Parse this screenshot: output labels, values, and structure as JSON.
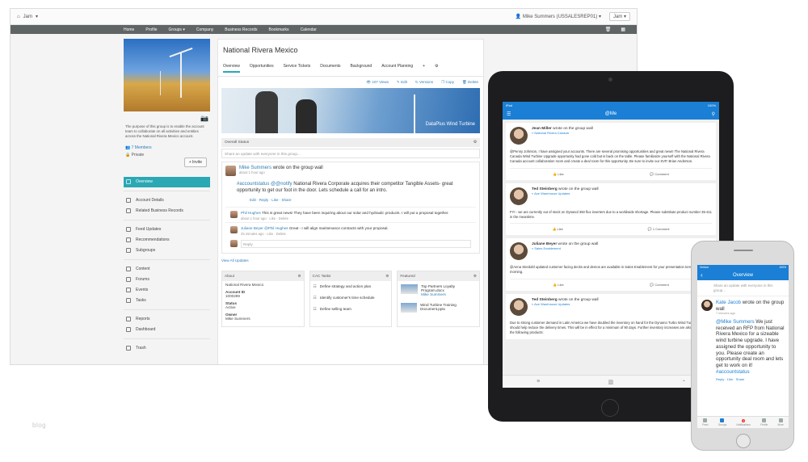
{
  "desktop": {
    "topbar": {
      "brand": "Jam",
      "user": "Mike Summers (USSALESREP01)",
      "jam_button": "Jam"
    },
    "nav": [
      "Home",
      "Profile",
      "Groups",
      "Company",
      "Business Records",
      "Bookmarks",
      "Calendar"
    ],
    "group": {
      "description": "The purpose of this group is to enable the account team to collaborate on all activities and entities across the National Rivera Mexico account.",
      "members": "7 Members",
      "privacy": "Private",
      "invite": "+ Invite"
    },
    "sidebar": [
      "Overview",
      "Account Details",
      "Related Business Records",
      "Feed Updates",
      "Recommendations",
      "Subgroups",
      "Content",
      "Forums",
      "Events",
      "Tasks",
      "Reports",
      "Dashboard",
      "Trash"
    ],
    "title": "National Rivera Mexico",
    "tabs": [
      "Overview",
      "Opportunities",
      "Service Tickets",
      "Documents",
      "Background",
      "Account Planning",
      "+"
    ],
    "actions": [
      "107 Views",
      "Edit",
      "Versions",
      "Copy",
      "Delete"
    ],
    "banner_caption": "DataPlus Wind Turbine",
    "status_header": "Overall Status",
    "share_placeholder": "Share an update with everyone in this group...",
    "post": {
      "author": "Mike Summers",
      "verb": "wrote on the group wall",
      "time": "about 1 hour ago",
      "tag1": "#accountstatus",
      "tag2": "@@notify",
      "body": " National Rivera Corporate acquires their competitor Tangible Assets- great opportunity to get our foot in the door. Lets schedule a call for an intro.",
      "links": "Edit · Reply · Like · Share"
    },
    "replies": [
      {
        "author": "Phil Hughes",
        "body": " This is great news! They have been inquiring about our solar and hydraulic products. I will put a proposal together.",
        "time": "about 1 hour ago · Like · Delete"
      },
      {
        "author": "Juliane Beyer",
        "mention": " @Phil Hughes",
        "body": " Great - I will align maintenance contracts with your proposal.",
        "time": "25 minutes ago · Like · Delete"
      }
    ],
    "reply_placeholder": "Reply",
    "view_all": "View All Updates",
    "widgets": {
      "about": {
        "title": "About",
        "name": "National Rivera Mexico",
        "id_label": "Account ID",
        "id_value": "1000289",
        "status_label": "Status",
        "status_value": "Active",
        "owner_label": "Owner",
        "owner_value": "Mike Summers"
      },
      "tasks": {
        "title": "CAC Tasks",
        "items": [
          "Define strategy and action plan",
          "Identify customer's time schedule",
          "Define selling team"
        ]
      },
      "featured": {
        "title": "Featured",
        "items": [
          {
            "title": "Top Partners Loyalty Program.docx",
            "by": "Mike Summers"
          },
          {
            "title": "Wind Turbine Training Document.pptx",
            "by": ""
          }
        ]
      }
    }
  },
  "tablet": {
    "status_left": "iPad",
    "status_right": "100%",
    "title": "@Me",
    "cards": [
      {
        "name": "Jean Miller",
        "verb": "wrote on the group wall",
        "group": "» National Rivera Canada",
        "body": "@Penny Johnson, I have assigned your accounts. There are several promising opportunities and great news! The National Rivera Canada Wind Turbine Upgrade opportunity had gone cold but is back on the table. Please familiarize yourself with the National Rivera Canada account collaboration room and create a deal room for this opportunity. Be sure to invite our SVP, Brian Anderson.",
        "like": "Like",
        "comment": "Comment"
      },
      {
        "name": "Ted Steinberg",
        "verb": "wrote on the group wall",
        "group": "» Ace Warehouse Updates",
        "body": "FYI - we are currently out of stock on Dynasol 350 flux inverters due to a worldwide shortage. Please substitute product number 35-411 in the meantime.",
        "like": "Like",
        "comment": "1 Comment"
      },
      {
        "name": "Juliane Beyer",
        "verb": "wrote on the group wall",
        "group": "» Sales Enablement",
        "body": "@Anna Stordahl updated customer facing decks and demos are available in Sales Enablement for your presentation tomorrow morning.",
        "like": "Like",
        "comment": "Comment"
      },
      {
        "name": "Ted Steinberg",
        "verb": "wrote on the group wall",
        "group": "» Ace Warehouse Updates",
        "body": "Due to strong customer demand in Latin America we have doubled the inventory on hand for the Dynamo Turbo Wind Turbine. This should help reduce the delivery times. This will be in effect for a minimum of 90 days. Further inventory increases are also in effect for the following products:",
        "like": "",
        "comment": ""
      }
    ]
  },
  "phone": {
    "status_left": "Verizon",
    "status_right": "100%",
    "title": "Overview",
    "share_placeholder": "Share an update with everyone in this group...",
    "post": {
      "author": "Kate Jacob",
      "verb": " wrote on the group wall",
      "time": "7 minutes ago",
      "mention": "@Mike Summers",
      "body": " We just received an RFP from National Rivera Mexico for a sizeable wind turbine upgrade. I have assigned the opportunity to you. Please create an opportunity deal room and lets get to work on it!",
      "tag": " #accountstatus",
      "links": "Reply · Like · Share"
    },
    "tabs": [
      "Feed",
      "Groups",
      "Notifications",
      "Profile",
      "More"
    ],
    "badge": "2"
  },
  "watermark": "blog",
  "colors": {
    "accent": "#2aa8b4",
    "link": "#2f7db5",
    "mobile_bar": "#1a7fd5",
    "navbar": "#5f6465"
  }
}
